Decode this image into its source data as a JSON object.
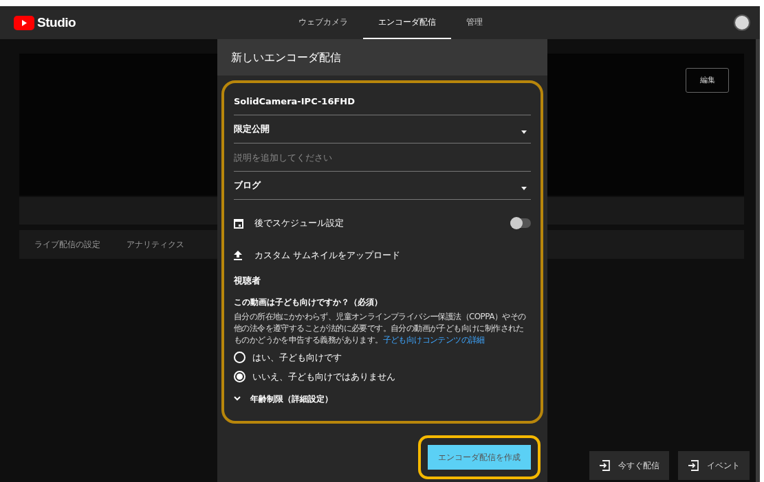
{
  "top_bar": {
    "logo_text": "Studio",
    "tabs": [
      {
        "label": "ウェブカメラ",
        "selected": false
      },
      {
        "label": "エンコーダ配信",
        "selected": true
      },
      {
        "label": "管理",
        "selected": false
      }
    ]
  },
  "background": {
    "edit_button": "編集",
    "tabs": [
      "ライブ配信の設定",
      "アナリティクス"
    ],
    "actions": [
      {
        "label": "今すぐ配信"
      },
      {
        "label": "イベント"
      }
    ]
  },
  "dialog": {
    "title": "新しいエンコーダ配信",
    "fields": [
      {
        "kind": "text",
        "value": "SolidCamera-IPC-16FHD"
      },
      {
        "kind": "select",
        "value": "限定公開"
      },
      {
        "kind": "text",
        "placeholder": "説明を追加してください"
      },
      {
        "kind": "select",
        "value": "ブログ"
      }
    ],
    "schedule": {
      "label": "後でスケジュール設定",
      "on": false
    },
    "upload_label": "カスタム サムネイルをアップロード",
    "audience": {
      "heading": "視聴者",
      "question": "この動画は子ども向けですか？（必須）",
      "description": "自分の所在地にかかわらず、児童オンラインプライバシー保護法（COPPA）やその他の法令を遵守することが法的に必要です。自分の動画が子ども向けに制作されたものかどうかを申告する義務があります。",
      "link": "子ども向けコンテンツの詳細",
      "options": [
        {
          "label": "はい、子ども向けです",
          "selected": false
        },
        {
          "label": "いいえ、子ども向けではありません",
          "selected": true
        }
      ]
    },
    "age_restriction": {
      "label": "年齢制限（詳細設定）",
      "expanded": false
    },
    "create_button": "エンコーダ配信を作成"
  }
}
